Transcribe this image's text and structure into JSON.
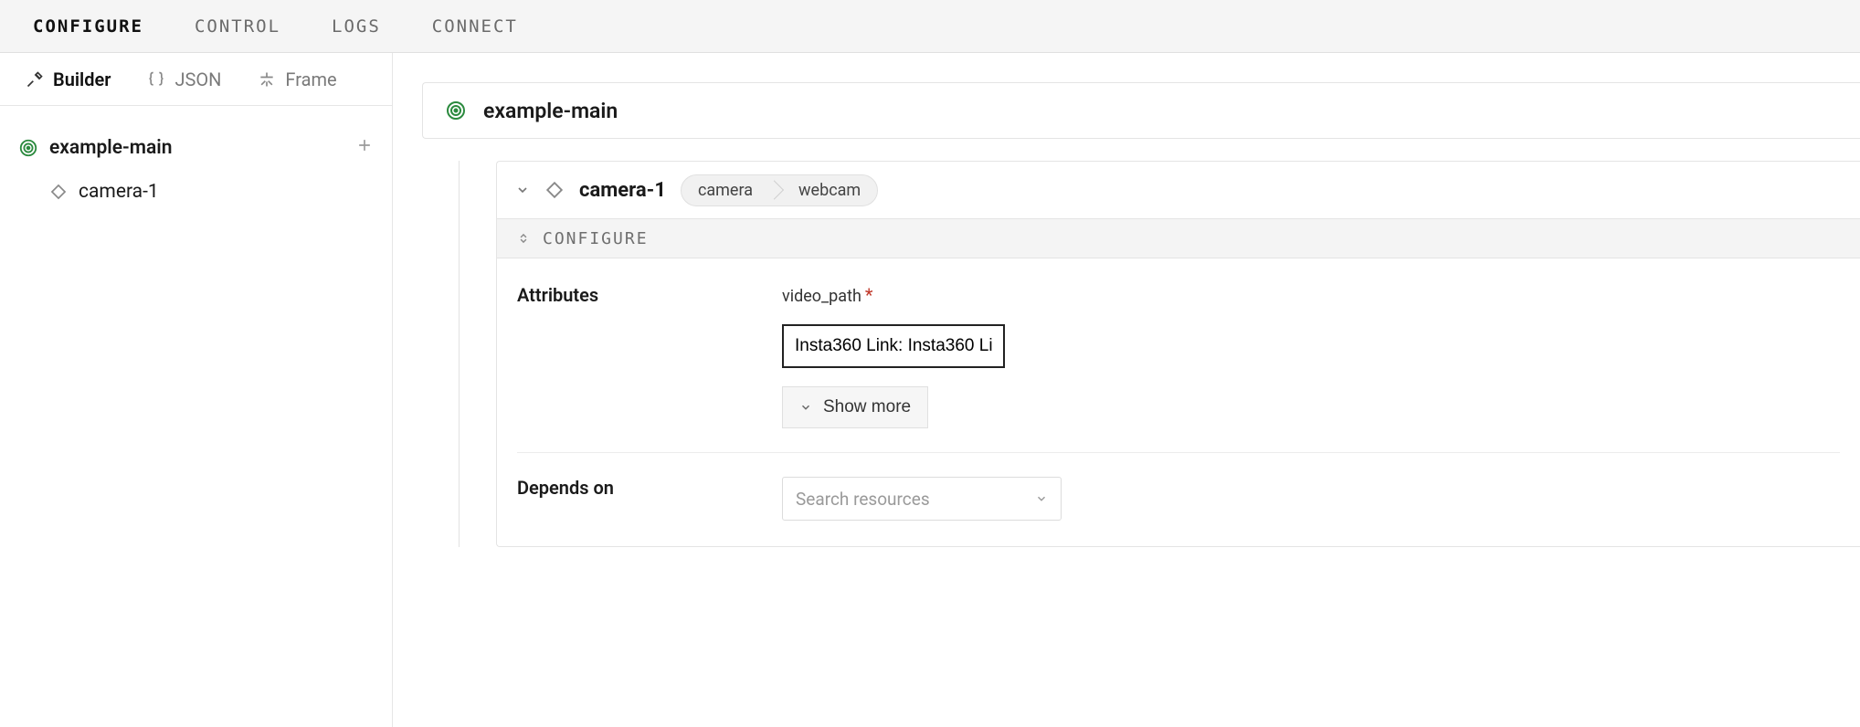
{
  "topTabs": {
    "configure": "CONFIGURE",
    "control": "CONTROL",
    "logs": "LOGS",
    "connect": "CONNECT"
  },
  "sidebarTabs": {
    "builder": "Builder",
    "json": "JSON",
    "frame": "Frame"
  },
  "tree": {
    "root": "example-main",
    "child": "camera-1"
  },
  "content": {
    "headerTitle": "example-main",
    "resource": {
      "name": "camera-1",
      "crumb1": "camera",
      "crumb2": "webcam"
    },
    "sectionLabel": "CONFIGURE",
    "attributes": {
      "label": "Attributes",
      "videoPathLabel": "video_path",
      "videoPathValue": "Insta360 Link: Insta360 Li",
      "showMore": "Show more"
    },
    "dependsOn": {
      "label": "Depends on",
      "placeholder": "Search resources"
    }
  }
}
